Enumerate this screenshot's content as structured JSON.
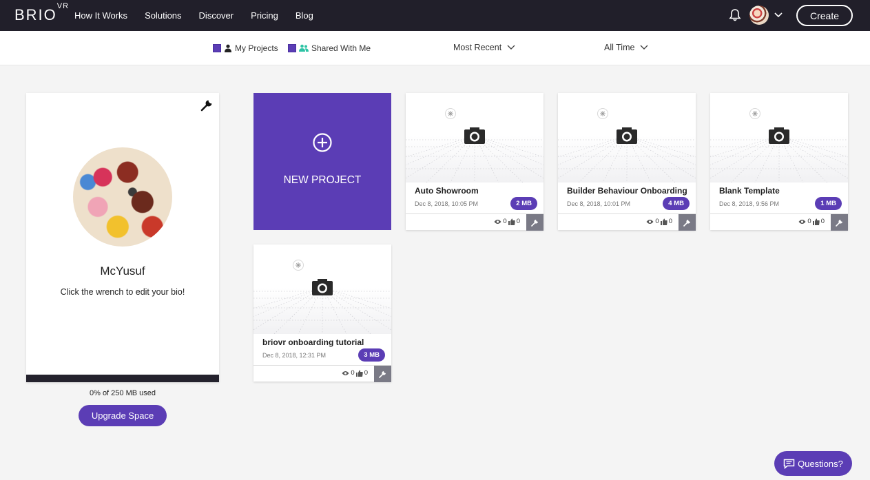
{
  "brand": {
    "name": "BRIO",
    "suffix": "VR"
  },
  "nav": {
    "links": [
      "How It Works",
      "Solutions",
      "Discover",
      "Pricing",
      "Blog"
    ],
    "create_label": "Create"
  },
  "filters": {
    "my_projects": "My Projects",
    "shared_with_me": "Shared With Me",
    "sort": "Most Recent",
    "time": "All Time"
  },
  "profile": {
    "name": "McYusuf",
    "bio": "Click the wrench to edit your bio!",
    "storage": "0% of 250 MB used",
    "upgrade_label": "Upgrade Space"
  },
  "new_project_label": "NEW PROJECT",
  "projects": [
    {
      "title": "Auto Showroom",
      "date": "Dec 8, 2018, 10:05 PM",
      "size": "2 MB",
      "views": "0",
      "likes": "0"
    },
    {
      "title": "Builder Behaviour Onboarding",
      "date": "Dec 8, 2018, 10:01 PM",
      "size": "4 MB",
      "views": "0",
      "likes": "0"
    },
    {
      "title": "Blank Template",
      "date": "Dec 8, 2018, 9:56 PM",
      "size": "1 MB",
      "views": "0",
      "likes": "0"
    },
    {
      "title": "briovr onboarding tutorial",
      "date": "Dec 8, 2018, 12:31 PM",
      "size": "3 MB",
      "views": "0",
      "likes": "0"
    }
  ],
  "questions_label": "Questions?",
  "colors": {
    "accent": "#5b3db5",
    "nav_bg": "#211f2a"
  }
}
